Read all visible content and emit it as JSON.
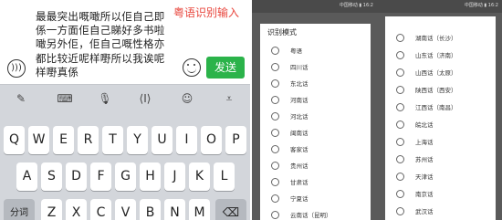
{
  "left_screen": {
    "message": "最最突出嘅噉所以佢自己即係一方面佢自己睇好多书啦噉另外佢，佢自己嘅性格亦都比较近呢样嘢所以我诶呢样嘢真係",
    "overlay_label": "粤语识别输入",
    "send_label": "发送",
    "voice_icon": "voice-icon",
    "keyboard_rows": [
      [
        "Q",
        "W",
        "E",
        "R",
        "T",
        "Y",
        "U",
        "I",
        "O",
        "P"
      ],
      [
        "A",
        "S",
        "D",
        "F",
        "G",
        "H",
        "J",
        "K",
        "L"
      ],
      [
        "分词",
        "Z",
        "X",
        "C",
        "V",
        "B",
        "N",
        "M",
        "⌫"
      ]
    ],
    "toolbar_icons": [
      "handwriting-icon",
      "keyboard-icon",
      "microphone-icon",
      "cursor-icon",
      "emoji-icon",
      "collapse-icon"
    ]
  },
  "mid_screen": {
    "status_text": "中国移动 ▮ 16:2",
    "title": "识别模式",
    "options": [
      "粤语",
      "四川话",
      "东北话",
      "河南话",
      "河北话",
      "闽南话",
      "客家话",
      "贵州话",
      "甘肃话",
      "宁夏话",
      "云南话（昆明）"
    ]
  },
  "right_screen": {
    "status_text": "中国移动 ▮ 16:2",
    "options": [
      "湖南话（长沙）",
      "山东话（济南）",
      "山西话（太原）",
      "陕西话（西安）",
      "江西话（南昌）",
      "皖北话",
      "上海话",
      "苏州话",
      "天津话",
      "南京话",
      "武汉话"
    ]
  }
}
